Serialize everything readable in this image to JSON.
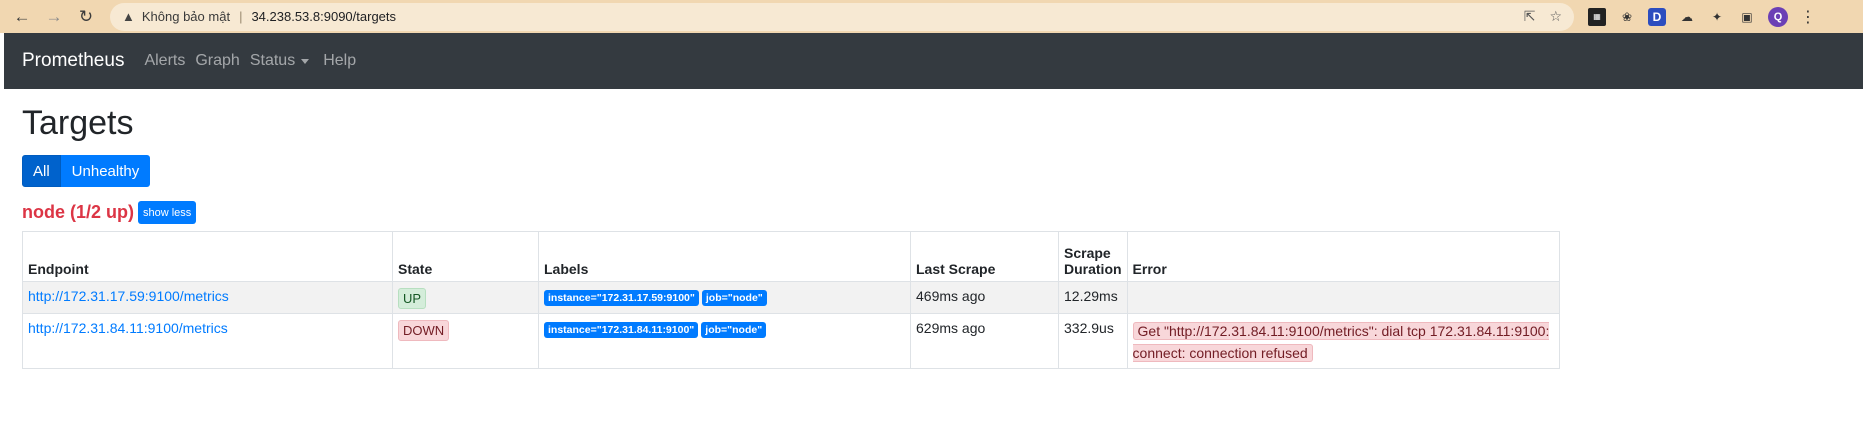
{
  "browser": {
    "security_text": "Không bảo mật",
    "url": "34.238.53.8:9090/targets",
    "avatar_letter": "Q"
  },
  "navbar": {
    "brand": "Prometheus",
    "links": [
      "Alerts",
      "Graph",
      "Status",
      "Help"
    ]
  },
  "page": {
    "title": "Targets",
    "filter_buttons": [
      "All",
      "Unhealthy"
    ],
    "job": {
      "title": "node (1/2 up)",
      "toggle_label": "show less"
    }
  },
  "table": {
    "headers": [
      "Endpoint",
      "State",
      "Labels",
      "Last Scrape",
      "Scrape Duration",
      "Error"
    ],
    "rows": [
      {
        "endpoint": "http://172.31.17.59:9100/metrics",
        "state": "UP",
        "labels": [
          "instance=\"172.31.17.59:9100\"",
          "job=\"node\""
        ],
        "last_scrape": "469ms ago",
        "duration": "12.29ms",
        "error": ""
      },
      {
        "endpoint": "http://172.31.84.11:9100/metrics",
        "state": "DOWN",
        "labels": [
          "instance=\"172.31.84.11:9100\"",
          "job=\"node\""
        ],
        "last_scrape": "629ms ago",
        "duration": "332.9us",
        "error": "Get \"http://172.31.84.11:9100/metrics\": dial tcp 172.31.84.11:9100: connect: connection refused"
      }
    ]
  }
}
